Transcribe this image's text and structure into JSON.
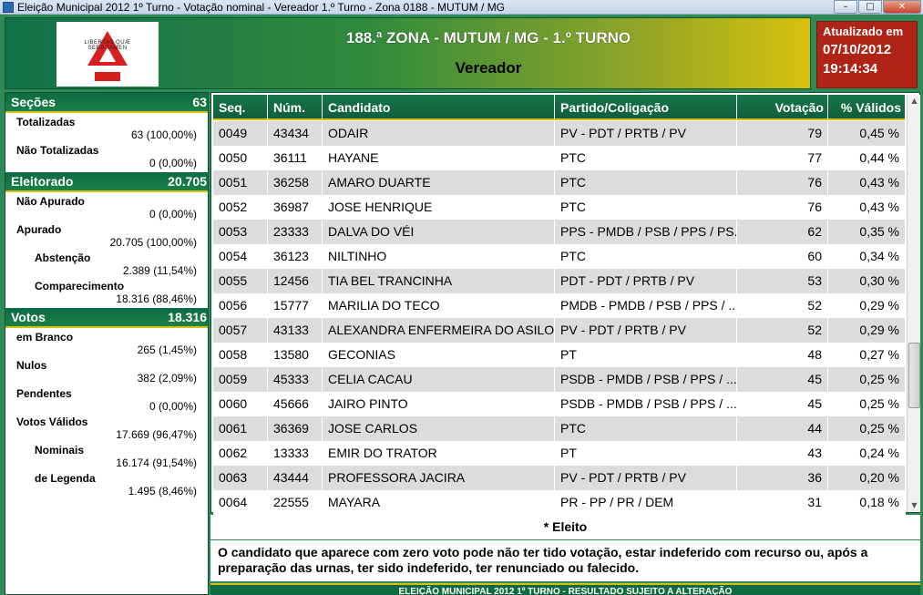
{
  "window": {
    "title": "Eleição Municipal 2012 1º Turno - Votação nominal - Vereador 1.º Turno - Zona 0188 - MUTUM / MG",
    "buttons": {
      "minimize": "–",
      "maximize": "□",
      "close": "✕"
    }
  },
  "header": {
    "logo": {
      "motto": "LIBERTAS QUÆ SERA TAMEN"
    },
    "zona": "188.ª ZONA - MUTUM / MG - 1.º TURNO",
    "cargo": "Vereador"
  },
  "updated": {
    "label": "Atualizado em",
    "date": "07/10/2012",
    "time": "19:14:34"
  },
  "left": {
    "secoes": {
      "title": "Seções",
      "value": "63",
      "totalizadas_label": "Totalizadas",
      "totalizadas_value": "63 (100,00%)",
      "nao_totalizadas_label": "Não Totalizadas",
      "nao_totalizadas_value": "0 (0,00%)"
    },
    "eleitorado": {
      "title": "Eleitorado",
      "value": "20.705",
      "nao_apurado_label": "Não Apurado",
      "nao_apurado_value": "0 (0,00%)",
      "apurado_label": "Apurado",
      "apurado_value": "20.705 (100,00%)",
      "abstencao_label": "Abstenção",
      "abstencao_value": "2.389 (11,54%)",
      "comparecimento_label": "Comparecimento",
      "comparecimento_value": "18.316 (88,46%)"
    },
    "votos": {
      "title": "Votos",
      "value": "18.316",
      "branco_label": "em Branco",
      "branco_value": "265 (1,45%)",
      "nulos_label": "Nulos",
      "nulos_value": "382 (2,09%)",
      "pendentes_label": "Pendentes",
      "pendentes_value": "0 (0,00%)",
      "validos_label": "Votos Válidos",
      "validos_value": "17.669 (96,47%)",
      "nominais_label": "Nominais",
      "nominais_value": "16.174 (91,54%)",
      "legenda_label": "de Legenda",
      "legenda_value": "1.495 (8,46%)"
    }
  },
  "table": {
    "headers": {
      "seq": "Seq.",
      "num": "Núm.",
      "cand": "Candidato",
      "partido": "Partido/Coligação",
      "votacao": "Votação",
      "validos": "% Válidos"
    },
    "rows": [
      {
        "seq": "0049",
        "num": "43434",
        "cand": "ODAIR",
        "partido": "PV - PDT / PRTB / PV",
        "votacao": "79",
        "validos": "0,45 %"
      },
      {
        "seq": "0050",
        "num": "36111",
        "cand": "HAYANE",
        "partido": "PTC",
        "votacao": "77",
        "validos": "0,44 %"
      },
      {
        "seq": "0051",
        "num": "36258",
        "cand": "AMARO DUARTE",
        "partido": "PTC",
        "votacao": "76",
        "validos": "0,43 %"
      },
      {
        "seq": "0052",
        "num": "36987",
        "cand": "JOSE HENRIQUE",
        "partido": "PTC",
        "votacao": "76",
        "validos": "0,43 %"
      },
      {
        "seq": "0053",
        "num": "23333",
        "cand": "DALVA DO VÉI",
        "partido": "PPS - PMDB / PSB / PPS / PS...",
        "votacao": "62",
        "validos": "0,35 %"
      },
      {
        "seq": "0054",
        "num": "36123",
        "cand": "NILTINHO",
        "partido": "PTC",
        "votacao": "60",
        "validos": "0,34 %"
      },
      {
        "seq": "0055",
        "num": "12456",
        "cand": "TIA BEL TRANCINHA",
        "partido": "PDT - PDT / PRTB / PV",
        "votacao": "53",
        "validos": "0,30 %"
      },
      {
        "seq": "0056",
        "num": "15777",
        "cand": "MARILIA DO TECO",
        "partido": "PMDB - PMDB / PSB / PPS / ...",
        "votacao": "52",
        "validos": "0,29 %"
      },
      {
        "seq": "0057",
        "num": "43133",
        "cand": "ALEXANDRA ENFERMEIRA DO ASILO",
        "partido": "PV - PDT / PRTB / PV",
        "votacao": "52",
        "validos": "0,29 %"
      },
      {
        "seq": "0058",
        "num": "13580",
        "cand": "GECONIAS",
        "partido": "PT",
        "votacao": "48",
        "validos": "0,27 %"
      },
      {
        "seq": "0059",
        "num": "45333",
        "cand": "CELIA CACAU",
        "partido": "PSDB - PMDB / PSB / PPS / ...",
        "votacao": "45",
        "validos": "0,25 %"
      },
      {
        "seq": "0060",
        "num": "45666",
        "cand": "JAIRO PINTO",
        "partido": "PSDB - PMDB / PSB / PPS / ...",
        "votacao": "45",
        "validos": "0,25 %"
      },
      {
        "seq": "0061",
        "num": "36369",
        "cand": "JOSE CARLOS",
        "partido": "PTC",
        "votacao": "44",
        "validos": "0,25 %"
      },
      {
        "seq": "0062",
        "num": "13333",
        "cand": "EMIR DO TRATOR",
        "partido": "PT",
        "votacao": "43",
        "validos": "0,24 %"
      },
      {
        "seq": "0063",
        "num": "43444",
        "cand": "PROFESSORA JACIRA",
        "partido": "PV - PDT / PRTB / PV",
        "votacao": "36",
        "validos": "0,20 %"
      },
      {
        "seq": "0064",
        "num": "22555",
        "cand": "MAYARA",
        "partido": "PR - PP / PR / DEM",
        "votacao": "31",
        "validos": "0,18 %"
      }
    ],
    "scroll": {
      "up": "▲",
      "down": "▼"
    }
  },
  "legend": {
    "eleito": "* Eleito"
  },
  "note": "O candidato que aparece com zero voto pode não ter tido votação, estar indeferido com recurso ou, após a preparação das urnas, ter sido indeferido, ter renunciado ou falecido.",
  "footer": "ELEIÇÃO MUNICIPAL 2012 1º TURNO - RESULTADO SUJEITO A ALTERAÇÃO"
}
